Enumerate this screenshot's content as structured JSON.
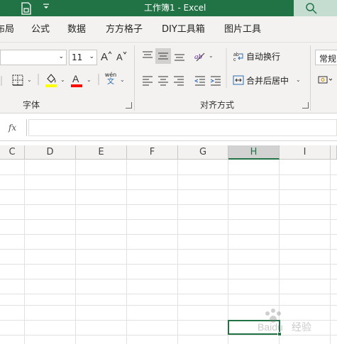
{
  "titlebar": {
    "title": "工作簿1  -  Excel",
    "qat_icon": "dropdown-icon",
    "save_icon": "file-save-icon",
    "search_icon": "search-icon",
    "accent": "#217346"
  },
  "tabs": [
    "布局",
    "公式",
    "数据",
    "方方格子",
    "DIY工具箱",
    "图片工具"
  ],
  "ribbon": {
    "font_name": "",
    "font_size": "11",
    "increase_font_icon": "A^",
    "decrease_font_icon": "A˅",
    "border_icon": "border-icon",
    "fill_color": "#ffff00",
    "font_color": "#ff0000",
    "phonetic_top": "wén",
    "phonetic_bottom": "文",
    "wrap_text": "自动换行",
    "merge_center": "合并后居中",
    "number_format": "常规",
    "group_font": "字体",
    "group_alignment": "对齐方式"
  },
  "formula_bar": {
    "fx_label": "fx",
    "value": ""
  },
  "columns": [
    "C",
    "D",
    "E",
    "F",
    "G",
    "H",
    "I"
  ],
  "active_column": "H",
  "watermark": "Baidu 经验"
}
